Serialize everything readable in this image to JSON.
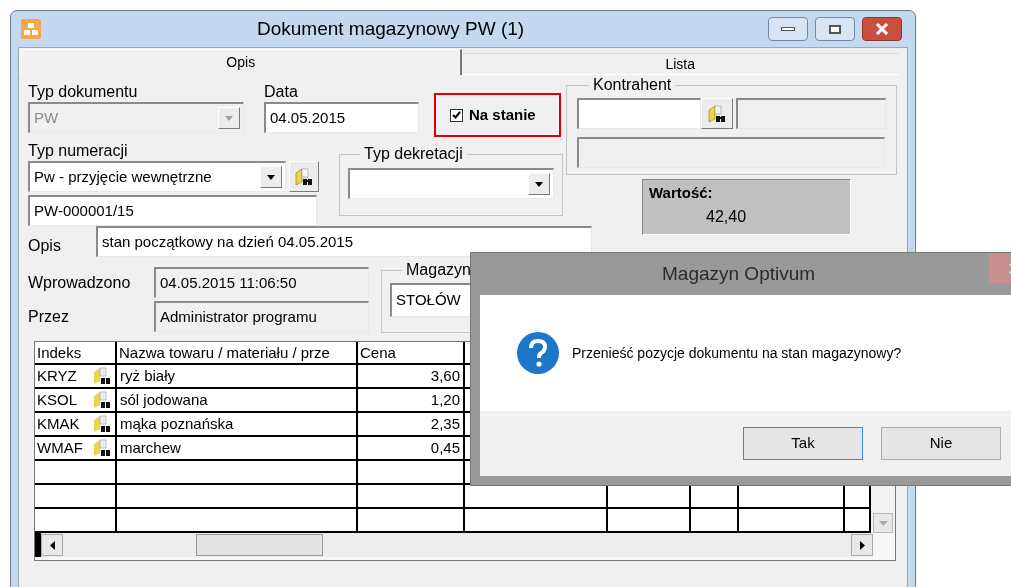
{
  "window": {
    "title": "Dokument magazynowy PW (1)"
  },
  "tabs": [
    {
      "label": "Opis",
      "selected": true
    },
    {
      "label": "Lista",
      "selected": false
    }
  ],
  "typ_dokumentu": {
    "label": "Typ dokumentu",
    "value": "PW",
    "disabled": true
  },
  "data": {
    "label": "Data",
    "value": "04.05.2015"
  },
  "na_stanie": {
    "label": "Na stanie",
    "checked": true
  },
  "kontrahent": {
    "label": "Kontrahent"
  },
  "typ_numeracji": {
    "label": "Typ numeracji",
    "value": "Pw  - przyjęcie wewnętrzne"
  },
  "numer": {
    "value": "PW-000001/15"
  },
  "typ_dekretacji": {
    "label": "Typ dekretacji"
  },
  "wartosc": {
    "label": "Wartość:",
    "value": "42,40"
  },
  "opis": {
    "label": "Opis",
    "value": "stan początkowy na dzień 04.05.2015"
  },
  "wprowadzono": {
    "label": "Wprowadzono",
    "value": "04.05.2015 11:06:50"
  },
  "przez": {
    "label": "Przez",
    "value": "Administrator programu"
  },
  "magazyn": {
    "label": "Magazyn",
    "value": "STOŁÓW"
  },
  "table": {
    "columns": [
      "Indeks",
      "Nazwa towaru / materiału / prze",
      "Cena"
    ],
    "rows": [
      {
        "indeks": "KRYZ",
        "nazwa": "ryż biały",
        "cena": "3,60"
      },
      {
        "indeks": "KSOL",
        "nazwa": "sól jodowana",
        "cena": "1,20"
      },
      {
        "indeks": "KMAK",
        "nazwa": "mąka poznańska",
        "cena": "2,35"
      },
      {
        "indeks": "WMAF",
        "nazwa": "marchew",
        "cena": "0,45"
      }
    ]
  },
  "dialog": {
    "title": "Magazyn Optivum",
    "message": "Przenieść pozycje dokumentu na stan magazynowy?",
    "buttons": [
      {
        "label": "Tak",
        "selected": true
      },
      {
        "label": "Nie",
        "selected": false
      }
    ]
  }
}
